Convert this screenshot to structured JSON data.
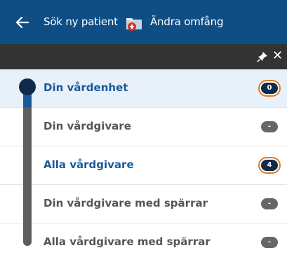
{
  "header": {
    "search_label": "Sök ny patient",
    "scope_label": "Ändra omfång"
  },
  "rows": [
    {
      "label": "Din vårdenhet",
      "badge": "0",
      "active": true
    },
    {
      "label": "Din vårdgivare",
      "badge": "-"
    },
    {
      "label": "Alla vårdgivare",
      "badge": "4"
    },
    {
      "label": "Din vårdgivare med spärrar",
      "badge": "-"
    },
    {
      "label": "Alla vårdgivare med spärrar",
      "badge": "-"
    }
  ],
  "colors": {
    "header": "#0e4e85",
    "toolbar": "#333333",
    "accent_blue": "#1a5a9a",
    "highlight_ring": "#e07a27"
  }
}
